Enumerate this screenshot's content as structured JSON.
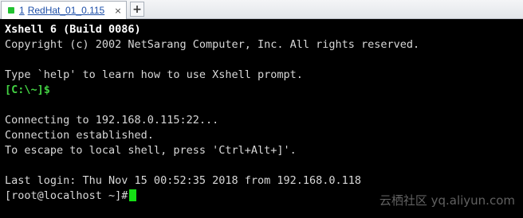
{
  "tab": {
    "index": "1",
    "title": "RedHat_01_0.115",
    "close_glyph": "×",
    "status_color": "#22c232",
    "add_glyph": "+"
  },
  "terminal": {
    "lines": [
      "Xshell 6 (Build 0086)",
      "Copyright (c) 2002 NetSarang Computer, Inc. All rights reserved.",
      "",
      "Type `help' to learn how to use Xshell prompt.",
      "[C:\\~]$",
      "",
      "Connecting to 192.168.0.115:22...",
      "Connection established.",
      "To escape to local shell, press 'Ctrl+Alt+]'.",
      "",
      "Last login: Thu Nov 15 00:52:35 2018 from 192.168.0.118",
      "[root@localhost ~]#"
    ],
    "cursor_color": "#15e115",
    "text_color": "#d8d8d8",
    "prompt_color": "#43d243"
  },
  "watermark": "云栖社区 yq.aliyun.com"
}
